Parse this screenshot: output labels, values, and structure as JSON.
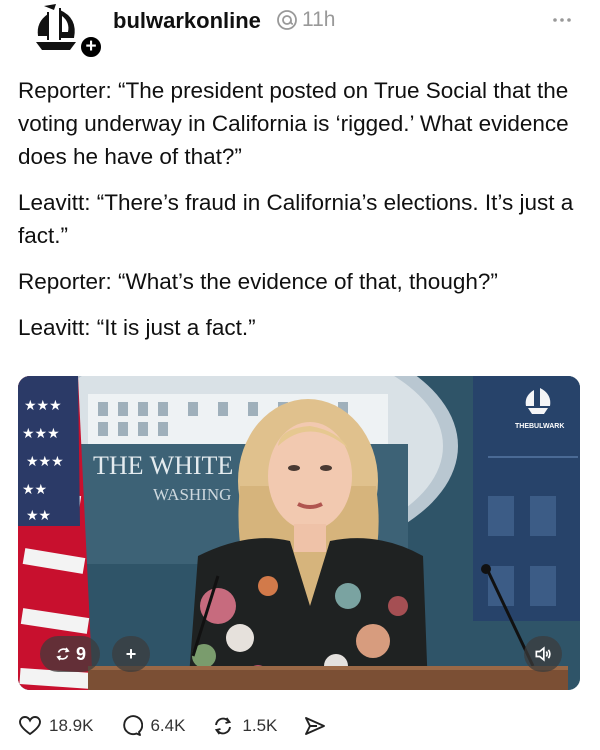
{
  "post": {
    "username": "bulwarkonline",
    "timestamp": "11h",
    "paragraphs": [
      "Reporter: “The president posted on True Social that the voting underway in California is ‘rigged.’ What evidence does he have of that?”",
      "Leavitt: “There’s fraud in California’s elections. It’s just a fact.”",
      "Reporter: “What’s the evidence of that, though?”",
      "Leavitt: “It is just a fact.”"
    ]
  },
  "media": {
    "backdrop_line1": "THE WHITE",
    "backdrop_line2": "WASHING",
    "watermark": "THEBULWARK",
    "repost_count": "9",
    "add_label": "+"
  },
  "actions": {
    "likes": "18.9K",
    "comments": "6.4K",
    "reposts": "1.5K"
  },
  "icons": {
    "avatar": "bulwark-ship-logo",
    "verified": "threads-icon",
    "more": "more-dots-icon",
    "like": "heart-icon",
    "comment": "comment-bubble-icon",
    "repost": "repost-icon",
    "share": "send-icon",
    "sound": "speaker-icon"
  }
}
